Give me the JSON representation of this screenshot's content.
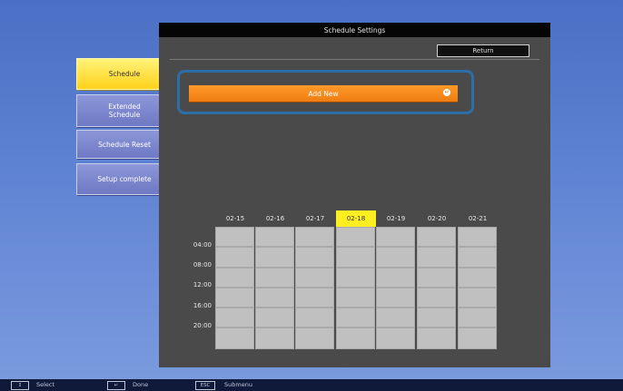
{
  "menu": {
    "items": [
      {
        "label": "Schedule",
        "active": true
      },
      {
        "label": "Extended\nSchedule",
        "active": false
      },
      {
        "label": "Schedule Reset",
        "active": false
      },
      {
        "label": "Setup complete",
        "active": false
      }
    ]
  },
  "panel": {
    "title": "Schedule Settings",
    "return_label": "Return",
    "add_new_label": "Add New",
    "enter_icon": "enter-icon"
  },
  "schedule": {
    "dates": [
      "02-15",
      "02-16",
      "02-17",
      "02-18",
      "02-19",
      "02-20",
      "02-21"
    ],
    "selected_date": "02-18",
    "times": [
      "04:00",
      "08:00",
      "12:00",
      "16:00",
      "20:00"
    ]
  },
  "footer": {
    "select_label": "Select",
    "done_label": "Done",
    "submenu_label": "Submenu",
    "esc_key": "ESC"
  },
  "colors": {
    "active_menu": "#ffd21a",
    "accent_orange": "#f07d12",
    "focus_outline": "#2c6fa8",
    "selected_date": "#ffee22"
  }
}
